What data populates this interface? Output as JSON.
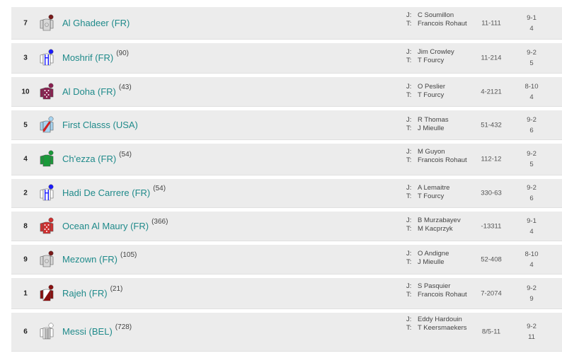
{
  "labels": {
    "jockey_prefix": "J:",
    "trainer_prefix": "T:"
  },
  "runners": [
    {
      "number": "7",
      "name": "Al Ghadeer (FR)",
      "rating": "",
      "jockey": "C Soumillon",
      "trainer": "Francois Rohaut",
      "form": "11-111",
      "odds": "9-1",
      "draw": "4",
      "silk": {
        "body": "#d8d8d8",
        "sleeves": "#d8d8d8",
        "cap": "#7a1a1a",
        "pattern": "plain",
        "detail": "#888888"
      }
    },
    {
      "number": "3",
      "name": "Moshrif (FR)",
      "rating": "(90)",
      "jockey": "Jim Crowley",
      "trainer": "T Fourcy",
      "form": "11-214",
      "odds": "9-2",
      "draw": "5",
      "silk": {
        "body": "#ffffff",
        "sleeves": "#ffffff",
        "cap": "#1a1aff",
        "pattern": "braces",
        "detail": "#1a1aff"
      }
    },
    {
      "number": "10",
      "name": "Al Doha (FR)",
      "rating": "(43)",
      "jockey": "O Peslier",
      "trainer": "T Fourcy",
      "form": "4-2121",
      "odds": "8-10",
      "draw": "4",
      "silk": {
        "body": "#8a2050",
        "sleeves": "#8a2050",
        "cap": "#8a2050",
        "pattern": "dots",
        "detail": "#ffffff"
      }
    },
    {
      "number": "5",
      "name": "First Classs (USA)",
      "rating": "",
      "jockey": "R Thomas",
      "trainer": "J Mieulle",
      "form": "51-432",
      "odds": "9-2",
      "draw": "6",
      "silk": {
        "body": "#a8d4f0",
        "sleeves": "#a8d4f0",
        "cap": "#a8d4f0",
        "pattern": "sash",
        "detail": "#d02020"
      }
    },
    {
      "number": "4",
      "name": "Ch'ezza (FR)",
      "rating": "(54)",
      "jockey": "M Guyon",
      "trainer": "Francois Rohaut",
      "form": "112-12",
      "odds": "9-2",
      "draw": "5",
      "silk": {
        "body": "#1a9a3a",
        "sleeves": "#1a9a3a",
        "cap": "#1a9a3a",
        "pattern": "plain",
        "detail": "#1a9a3a"
      }
    },
    {
      "number": "2",
      "name": "Hadi De Carrere (FR)",
      "rating": "(54)",
      "jockey": "A Lemaitre",
      "trainer": "T Fourcy",
      "form": "330-63",
      "odds": "9-2",
      "draw": "6",
      "silk": {
        "body": "#ffffff",
        "sleeves": "#ffffff",
        "cap": "#1a1aff",
        "pattern": "braces",
        "detail": "#1a1aff"
      }
    },
    {
      "number": "8",
      "name": "Ocean Al Maury (FR)",
      "rating": "(366)",
      "jockey": "B Murzabayev",
      "trainer": "M Kacprzyk",
      "form": "-13311",
      "odds": "9-1",
      "draw": "4",
      "silk": {
        "body": "#d03030",
        "sleeves": "#d03030",
        "cap": "#d03030",
        "pattern": "dots",
        "detail": "#ffffff"
      }
    },
    {
      "number": "9",
      "name": "Mezown (FR)",
      "rating": "(105)",
      "jockey": "O Andigne",
      "trainer": "J Mieulle",
      "form": "52-408",
      "odds": "8-10",
      "draw": "4",
      "silk": {
        "body": "#d8d8d8",
        "sleeves": "#d8d8d8",
        "cap": "#7a1a1a",
        "pattern": "plain",
        "detail": "#888888"
      }
    },
    {
      "number": "1",
      "name": "Rajeh (FR)",
      "rating": "(21)",
      "jockey": "S Pasquier",
      "trainer": "Francois Rohaut",
      "form": "7-2074",
      "odds": "9-2",
      "draw": "9",
      "silk": {
        "body": "#ffffff",
        "sleeves": "#8a1010",
        "cap": "#8a1010",
        "pattern": "halfdark",
        "detail": "#8a1010"
      }
    },
    {
      "number": "6",
      "name": "Messi (BEL)",
      "rating": "(728)",
      "jockey": "Eddy Hardouin",
      "trainer": "T Keersmaekers",
      "form": "8/5-11",
      "odds": "9-2",
      "draw": "11",
      "silk": {
        "body": "#ffffff",
        "sleeves": "#ffffff",
        "cap": "#ffffff",
        "pattern": "stripes",
        "detail": "#333333"
      }
    }
  ]
}
